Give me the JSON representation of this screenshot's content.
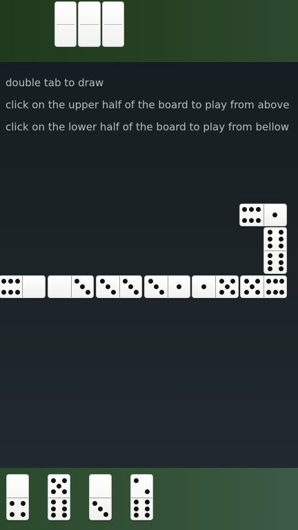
{
  "instructions": [
    "double tab to draw",
    "click on the upper half of the board to play from above",
    "click on the lower half of the board to play from bellow"
  ],
  "opponent_hand": {
    "hidden_tiles": 3
  },
  "board": {
    "chain": [
      [
        6,
        0
      ],
      [
        0,
        3
      ],
      [
        3,
        3
      ],
      [
        3,
        1
      ],
      [
        1,
        5
      ],
      [
        5,
        6
      ],
      [
        6,
        6
      ],
      [
        6,
        1
      ]
    ]
  },
  "player_hand": {
    "tiles": [
      [
        0,
        4
      ],
      [
        5,
        6
      ],
      [
        0,
        3
      ],
      [
        2,
        6
      ]
    ]
  },
  "colors": {
    "top_bar": "#274223",
    "bottom_bar": "#355238",
    "background": "#1b2327",
    "tile_face": "#ffffff",
    "pip": "#111111"
  }
}
